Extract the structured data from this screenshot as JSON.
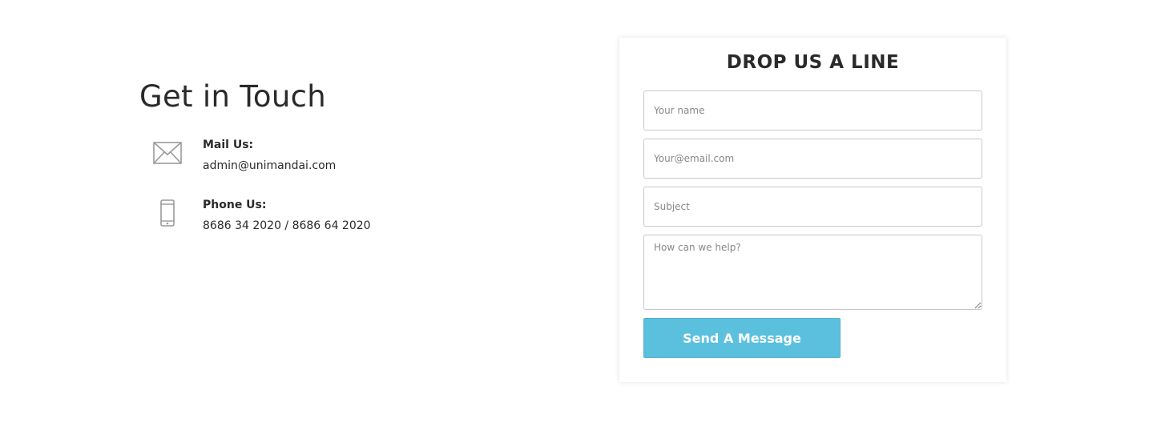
{
  "contact": {
    "heading": "Get in Touch",
    "mail": {
      "label": "Mail Us:",
      "value": "admin@unimandai.com",
      "icon": "envelope-icon"
    },
    "phone": {
      "label": "Phone Us:",
      "value": "8686 34 2020 / 8686 64 2020",
      "icon": "mobile-phone-icon"
    }
  },
  "form": {
    "title": "DROP US A LINE",
    "name_placeholder": "Your name",
    "email_placeholder": "Your@email.com",
    "subject_placeholder": "Subject",
    "message_placeholder": "How can we help?",
    "submit_label": "Send A Message"
  },
  "colors": {
    "button": "#5bc0de",
    "text": "#2a2a2a",
    "icon": "#9a9a9a"
  }
}
